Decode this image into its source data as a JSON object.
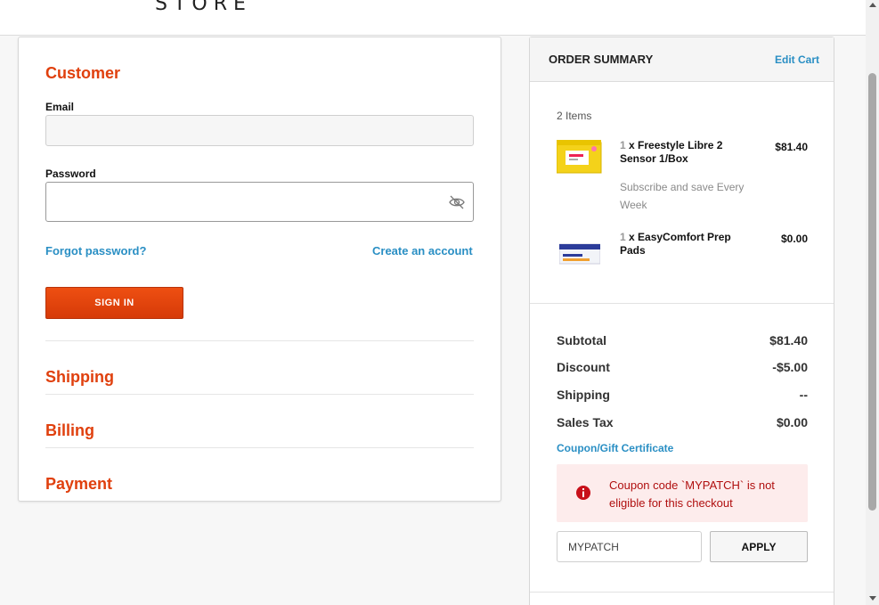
{
  "header": {
    "logo_text": "STORE"
  },
  "checkout": {
    "customer_title": "Customer",
    "email_label": "Email",
    "email_value": "",
    "password_label": "Password",
    "password_value": "",
    "forgot_password": "Forgot password?",
    "create_account": "Create an account",
    "sign_in": "SIGN IN",
    "shipping_title": "Shipping",
    "billing_title": "Billing",
    "payment_title": "Payment",
    "accent_color": "#e0400e"
  },
  "summary": {
    "title": "ORDER SUMMARY",
    "edit_cart": "Edit Cart",
    "items_count": "2 Items",
    "items": [
      {
        "qty": "1",
        "name": " x Freestyle Libre 2 Sensor 1/Box",
        "price": "$81.40",
        "subscription": "Subscribe and save Every Week",
        "image_icon": "product-box-yellow"
      },
      {
        "qty": "1",
        "name": " x EasyComfort Prep Pads",
        "price": "$0.00",
        "image_icon": "product-box-blue"
      }
    ],
    "subtotal_label": "Subtotal",
    "subtotal_value": "$81.40",
    "discount_label": "Discount",
    "discount_value": "-$5.00",
    "shipping_label": "Shipping",
    "shipping_value": "--",
    "tax_label": "Sales Tax",
    "tax_value": "$0.00",
    "coupon_link": "Coupon/Gift Certificate",
    "coupon_error": "Coupon code `MYPATCH` is not eligible for this checkout",
    "coupon_value": "MYPATCH",
    "apply": "APPLY",
    "link_color": "#2a8fc4",
    "error_color": "#b00f0f"
  }
}
